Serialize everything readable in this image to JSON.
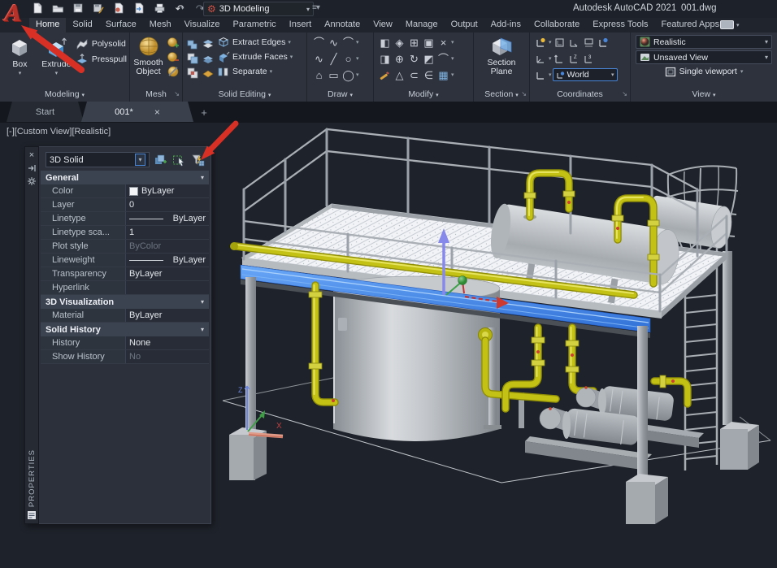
{
  "titlebar": {
    "logo": "A",
    "app_title": "Autodesk AutoCAD 2021",
    "doc_name": "001.dwg",
    "workspace_label": "3D Modeling",
    "qat_icons": [
      "new-file-icon",
      "open-folder-icon",
      "save-icon",
      "save-as-icon",
      "drawing-standards-icon",
      "export-icon",
      "print-icon",
      "undo-icon",
      "redo-icon",
      "workspace-gear-icon"
    ]
  },
  "ribbon": {
    "tabs": [
      {
        "label": "Home",
        "active": true
      },
      {
        "label": "Solid"
      },
      {
        "label": "Surface"
      },
      {
        "label": "Mesh"
      },
      {
        "label": "Visualize"
      },
      {
        "label": "Parametric"
      },
      {
        "label": "Insert"
      },
      {
        "label": "Annotate"
      },
      {
        "label": "View"
      },
      {
        "label": "Manage"
      },
      {
        "label": "Output"
      },
      {
        "label": "Add-ins"
      },
      {
        "label": "Collaborate"
      },
      {
        "label": "Express Tools"
      },
      {
        "label": "Featured Apps"
      }
    ],
    "panels": {
      "modeling": {
        "label": "Modeling",
        "box": "Box",
        "extrude": "Extrude",
        "polysolid": "Polysolid",
        "presspull": "Presspull"
      },
      "mesh": {
        "label": "Mesh",
        "smooth_object": "Smooth Object",
        "icons": [
          "smooth-more-icon",
          "smooth-less-icon",
          "smooth-off-icon"
        ]
      },
      "solid_editing": {
        "label": "Solid Editing",
        "extract_edges": "Extract Edges",
        "extrude_faces": "Extrude Faces",
        "separate": "Separate",
        "icons": [
          "union-icon",
          "subtract-icon",
          "intersect-icon",
          "slice-icon",
          "thicken-icon",
          "shell-icon"
        ]
      },
      "draw": {
        "label": "Draw",
        "icons": [
          "arc-icon",
          "polyline-icon",
          "arc-flyout-icon",
          "spline-icon",
          "line-icon",
          "circle-icon",
          "polygon-icon",
          "rectangle-icon",
          "ellipse-icon"
        ]
      },
      "modify": {
        "label": "Modify",
        "icons": [
          "mirror-icon",
          "3d-align-icon",
          "move-icon",
          "copy-icon",
          "trim-icon",
          "stretch-icon",
          "array-icon",
          "rotate-icon",
          "scale-icon",
          "fillet-icon",
          "erase-icon",
          "explode-icon",
          "offset-icon",
          "join-icon",
          "pattern-icon"
        ]
      },
      "section": {
        "label": "Section",
        "section_plane": "Section Plane"
      },
      "coordinates": {
        "label": "Coordinates",
        "ucs_value": "World",
        "icons": [
          "ucs-world-icon",
          "ucs-icon",
          "ucs-previous-icon",
          "ucs-object-icon",
          "ucs-view-icon",
          "ucs-origin-icon",
          "ucs-z-icon",
          "ucs-3point-icon",
          "ucs-named-icon"
        ]
      },
      "view": {
        "label": "View",
        "visual_style": "Realistic",
        "named_view": "Unsaved View",
        "viewport_config": "Single viewport"
      }
    }
  },
  "file_tabs": [
    {
      "label": "Start"
    },
    {
      "label": "001*",
      "active": true
    }
  ],
  "viewport": {
    "controls_label": "[-][Custom View][Realistic]",
    "ucs": {
      "z": "Z",
      "x": "X"
    }
  },
  "properties_palette": {
    "title": "PROPERTIES",
    "object_type": "3D Solid",
    "header_icons": [
      "toggle-pickadd-icon",
      "select-objects-icon",
      "quick-select-icon"
    ],
    "strip_icons": [
      "close-icon",
      "auto-hide-icon",
      "settings-gear-icon",
      "palette-menu-icon"
    ],
    "sections": [
      {
        "title": "General",
        "rows": [
          {
            "name": "Color",
            "value": "ByLayer",
            "swatch": true
          },
          {
            "name": "Layer",
            "value": "0"
          },
          {
            "name": "Linetype",
            "value": "ByLayer",
            "line": true
          },
          {
            "name": "Linetype sca...",
            "value": "1"
          },
          {
            "name": "Plot style",
            "value": "ByColor",
            "muted": true
          },
          {
            "name": "Lineweight",
            "value": "ByLayer",
            "line": true
          },
          {
            "name": "Transparency",
            "value": "ByLayer"
          },
          {
            "name": "Hyperlink",
            "value": ""
          }
        ]
      },
      {
        "title": "3D Visualization",
        "rows": [
          {
            "name": "Material",
            "value": "ByLayer"
          }
        ]
      },
      {
        "title": "Solid History",
        "rows": [
          {
            "name": "History",
            "value": "None"
          },
          {
            "name": "Show History",
            "value": "No",
            "muted": true
          }
        ]
      }
    ]
  },
  "colors": {
    "selection_blue": "#3e82ea",
    "pipe_yellow": "#c3c114",
    "annotation_red": "#d93025",
    "steel_gray": "#a9aeb4",
    "ribbon_bg": "#2d323d",
    "viewport_bg": "#1e222a"
  }
}
